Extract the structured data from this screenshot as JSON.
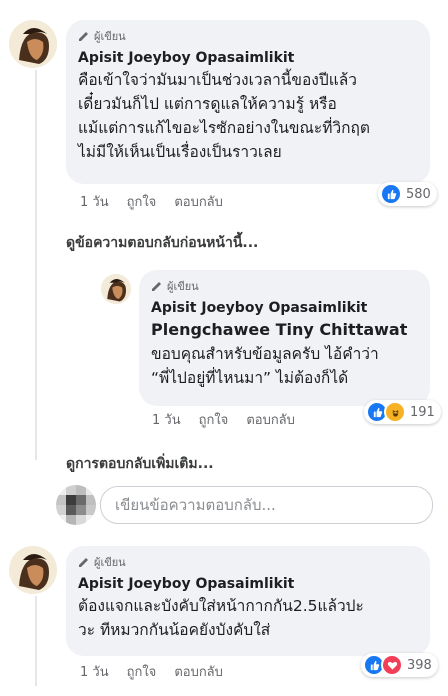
{
  "comment1": {
    "badge": "ผู้เขียน",
    "author": "Apisit Joeyboy Opasaimlikit",
    "lines": [
      "คือเข้าใจว่ามันมาเป็นช่วงเวลานี้ของปีแล้ว",
      "เดี๋ยวมันก็ไป แต่การดูแลให้ความรู้ หรือ",
      "แม้แต่การแก้ไขอะไรซักอย่างในขณะที่วิกฤต",
      "ไม่มีให้เห็นเป็นเรื่องเป็นราวเลย"
    ],
    "time": "1 วัน",
    "like": "ถูกใจ",
    "reply": "ตอบกลับ",
    "reaction_count": "580",
    "reaction_icons": [
      "like-icon"
    ]
  },
  "view_previous_replies": "ดูข้อความตอบกลับก่อนหน้านี้...",
  "reply1": {
    "badge": "ผู้เขียน",
    "author": "Apisit Joeyboy Opasaimlikit",
    "tagged": "Plengchawee Tiny Chittawat",
    "lines": [
      "ขอบคุณสำหรับข้อมูลครับ ไอ้คำว่า",
      "“พี่ไปอยู่ที่ไหนมา” ไม่ต้องก็ได้"
    ],
    "time": "1 วัน",
    "like": "ถูกใจ",
    "reply": "ตอบกลับ",
    "reaction_count": "191",
    "reaction_icons": [
      "like-icon",
      "haha-icon"
    ]
  },
  "view_more_replies": "ดูการตอบกลับเพิ่มเติม...",
  "reply_input": {
    "placeholder": "เขียนข้อความตอบกลับ..."
  },
  "comment2": {
    "badge": "ผู้เขียน",
    "author": "Apisit Joeyboy Opasaimlikit",
    "lines": [
      "ต้องแจกและบังคับใส่หน้ากากกัน2.5แล้วปะ",
      "วะ ทีหมวกกันน้อคยังบังคับใส่"
    ],
    "time": "1 วัน",
    "like": "ถูกใจ",
    "reply": "ตอบกลับ",
    "reaction_count": "398",
    "reaction_icons": [
      "like-icon",
      "love-icon"
    ]
  },
  "colors": {
    "like": "#1877f2",
    "love": "#f33e58",
    "haha": "#f7b125",
    "bubble": "#f0f2f5"
  }
}
